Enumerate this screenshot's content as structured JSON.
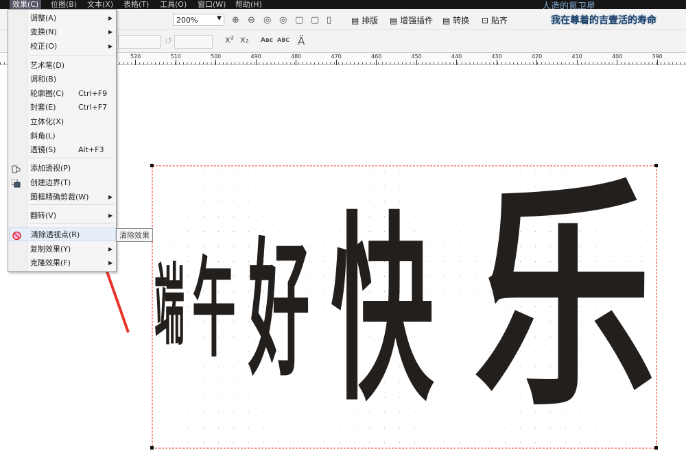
{
  "menubar": {
    "items": [
      "效果(C)",
      "位图(B)",
      "文本(X)",
      "表格(T)",
      "工具(O)",
      "窗口(W)",
      "帮助(H)"
    ],
    "window_title": "人造的氲卫星"
  },
  "toolbar": {
    "zoom": "200%",
    "buttons": [
      "排版",
      "增强插件",
      "转换",
      "贴齐"
    ],
    "slogan": "我在尊着的吉壹活的寿命",
    "text_buttons": [
      "x²",
      "x₂",
      "Aʙc",
      "ABC"
    ]
  },
  "ruler": {
    "labels": [
      "520",
      "510",
      "500",
      "490",
      "480",
      "470",
      "460",
      "450",
      "440",
      "430",
      "420",
      "410",
      "400",
      "390"
    ]
  },
  "menu": {
    "items": [
      {
        "label": "调整(A)",
        "sub": true
      },
      {
        "label": "变换(N)",
        "sub": true
      },
      {
        "label": "校正(O)",
        "sub": true
      },
      {
        "label": "艺术笔(D)"
      },
      {
        "label": "调和(B)"
      },
      {
        "label": "轮廓图(C)",
        "shortcut": "Ctrl+F9"
      },
      {
        "label": "封套(E)",
        "shortcut": "Ctrl+F7"
      },
      {
        "label": "立体化(X)"
      },
      {
        "label": "斜角(L)"
      },
      {
        "label": "透镜(S)",
        "shortcut": "Alt+F3"
      },
      {
        "label": "添加透视(P)"
      },
      {
        "label": "创建边界(T)"
      },
      {
        "label": "图框精确剪裁(W)",
        "sub": true
      },
      {
        "label": "翻转(V)",
        "sub": true
      },
      {
        "label": "清除透视点(R)"
      },
      {
        "label": "复制效果(Y)",
        "sub": true
      },
      {
        "label": "克隆效果(F)",
        "sub": true
      }
    ]
  },
  "tooltip": "清除效果",
  "artwork": {
    "text": [
      "端",
      "午",
      "好",
      "快",
      "乐"
    ]
  },
  "colors": {
    "accent": "#e8332a",
    "text": "#231f1c"
  }
}
